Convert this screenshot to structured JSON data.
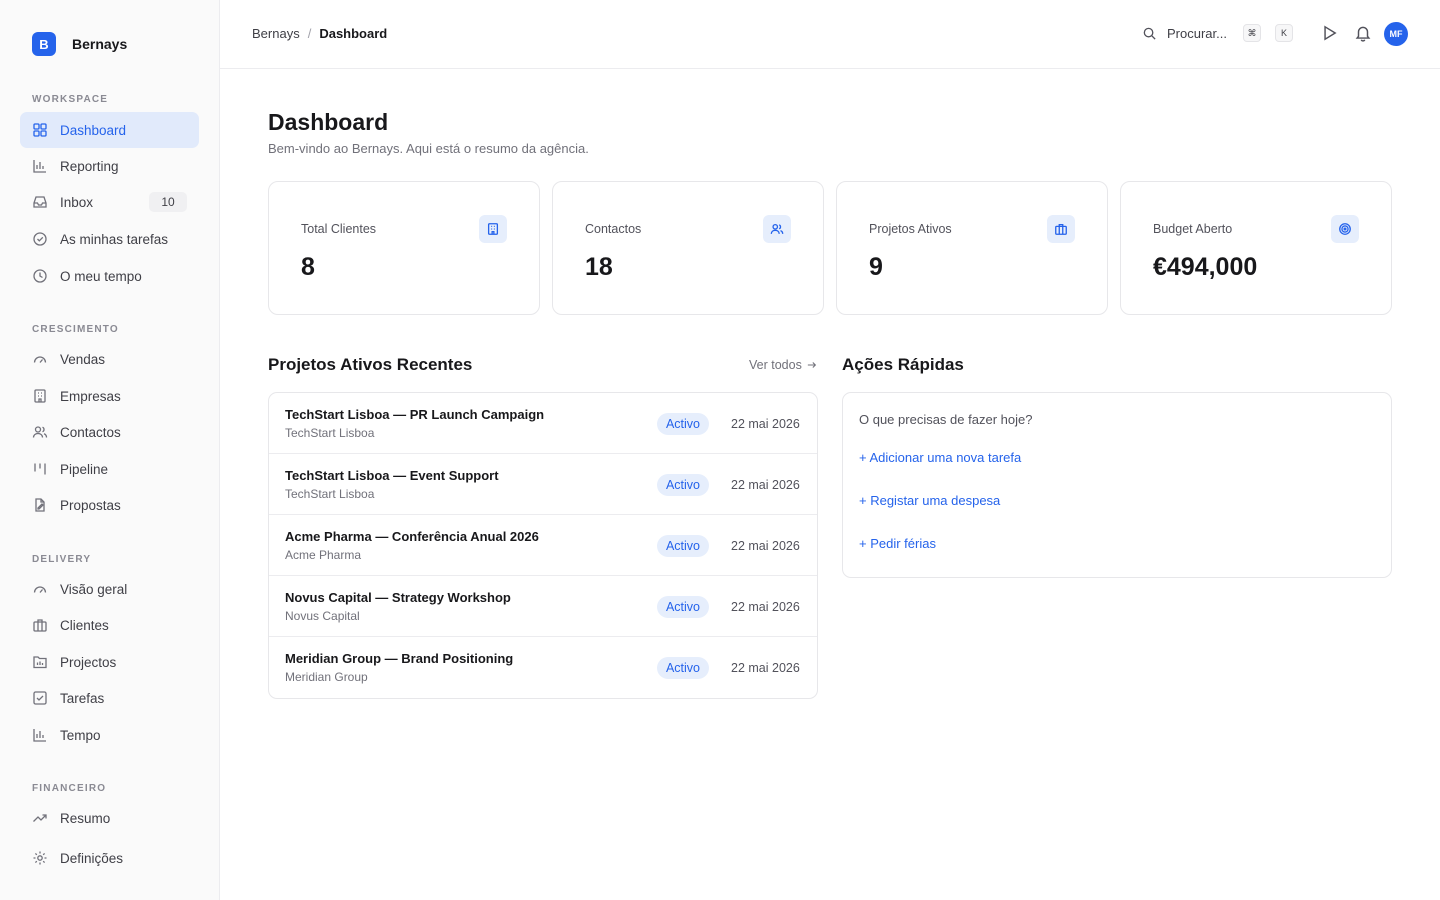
{
  "app": {
    "logo_letter": "B",
    "name": "Bernays"
  },
  "sidebar": {
    "sections": [
      {
        "title": "WORKSPACE",
        "items": [
          {
            "label": "Dashboard",
            "icon": "grid-icon",
            "active": true
          },
          {
            "label": "Reporting",
            "icon": "bar-chart-icon"
          },
          {
            "label": "Inbox",
            "icon": "inbox-icon",
            "badge": "10"
          },
          {
            "label": "As minhas tarefas",
            "icon": "check-circle-icon"
          },
          {
            "label": "O meu tempo",
            "icon": "clock-icon"
          }
        ]
      },
      {
        "title": "CRESCIMENTO",
        "items": [
          {
            "label": "Vendas",
            "icon": "gauge-icon"
          },
          {
            "label": "Empresas",
            "icon": "building-icon"
          },
          {
            "label": "Contactos",
            "icon": "users-icon"
          },
          {
            "label": "Pipeline",
            "icon": "kanban-icon"
          },
          {
            "label": "Propostas",
            "icon": "document-icon"
          }
        ]
      },
      {
        "title": "DELIVERY",
        "items": [
          {
            "label": "Visão geral",
            "icon": "gauge-icon"
          },
          {
            "label": "Clientes",
            "icon": "briefcase-icon"
          },
          {
            "label": "Projectos",
            "icon": "folder-icon"
          },
          {
            "label": "Tarefas",
            "icon": "checkbox-icon"
          },
          {
            "label": "Tempo",
            "icon": "bar-chart-icon"
          }
        ]
      },
      {
        "title": "FINANCEIRO",
        "items": [
          {
            "label": "Resumo",
            "icon": "trend-icon"
          }
        ]
      }
    ],
    "settings": {
      "label": "Definições",
      "icon": "gear-icon"
    }
  },
  "header": {
    "breadcrumb": [
      "Bernays",
      "Dashboard"
    ],
    "search_placeholder": "Procurar...",
    "shortcut_keys": [
      "⌘",
      "K"
    ],
    "user_initials": "MF"
  },
  "main": {
    "title": "Dashboard",
    "subtitle": "Bem-vindo ao Bernays. Aqui está o resumo da agência.",
    "stats": [
      {
        "label": "Total Clientes",
        "value": "8",
        "icon": "building-icon"
      },
      {
        "label": "Contactos",
        "value": "18",
        "icon": "users-icon"
      },
      {
        "label": "Projetos Ativos",
        "value": "9",
        "icon": "briefcase-icon"
      },
      {
        "label": "Budget Aberto",
        "value": "€494,000",
        "icon": "target-icon"
      }
    ],
    "recent_projects": {
      "title": "Projetos Ativos Recentes",
      "see_all": "Ver todos",
      "rows": [
        {
          "name": "TechStart Lisboa — PR Launch Campaign",
          "client": "TechStart Lisboa",
          "status": "Activo",
          "date": "22 mai 2026"
        },
        {
          "name": "TechStart Lisboa — Event Support",
          "client": "TechStart Lisboa",
          "status": "Activo",
          "date": "22 mai 2026"
        },
        {
          "name": "Acme Pharma — Conferência Anual 2026",
          "client": "Acme Pharma",
          "status": "Activo",
          "date": "22 mai 2026"
        },
        {
          "name": "Novus Capital — Strategy Workshop",
          "client": "Novus Capital",
          "status": "Activo",
          "date": "22 mai 2026"
        },
        {
          "name": "Meridian Group — Brand Positioning",
          "client": "Meridian Group",
          "status": "Activo",
          "date": "22 mai 2026"
        }
      ]
    },
    "quick_actions": {
      "title": "Ações Rápidas",
      "prompt": "O que precisas de fazer hoje?",
      "links": [
        "+ Adicionar uma nova tarefa",
        "+ Registar uma despesa",
        "+ Pedir férias"
      ]
    }
  },
  "colors": {
    "accent": "#2563eb",
    "accent_soft": "#e6eefc",
    "border": "#e7e7ea",
    "sidebar_bg": "#fafafa"
  }
}
